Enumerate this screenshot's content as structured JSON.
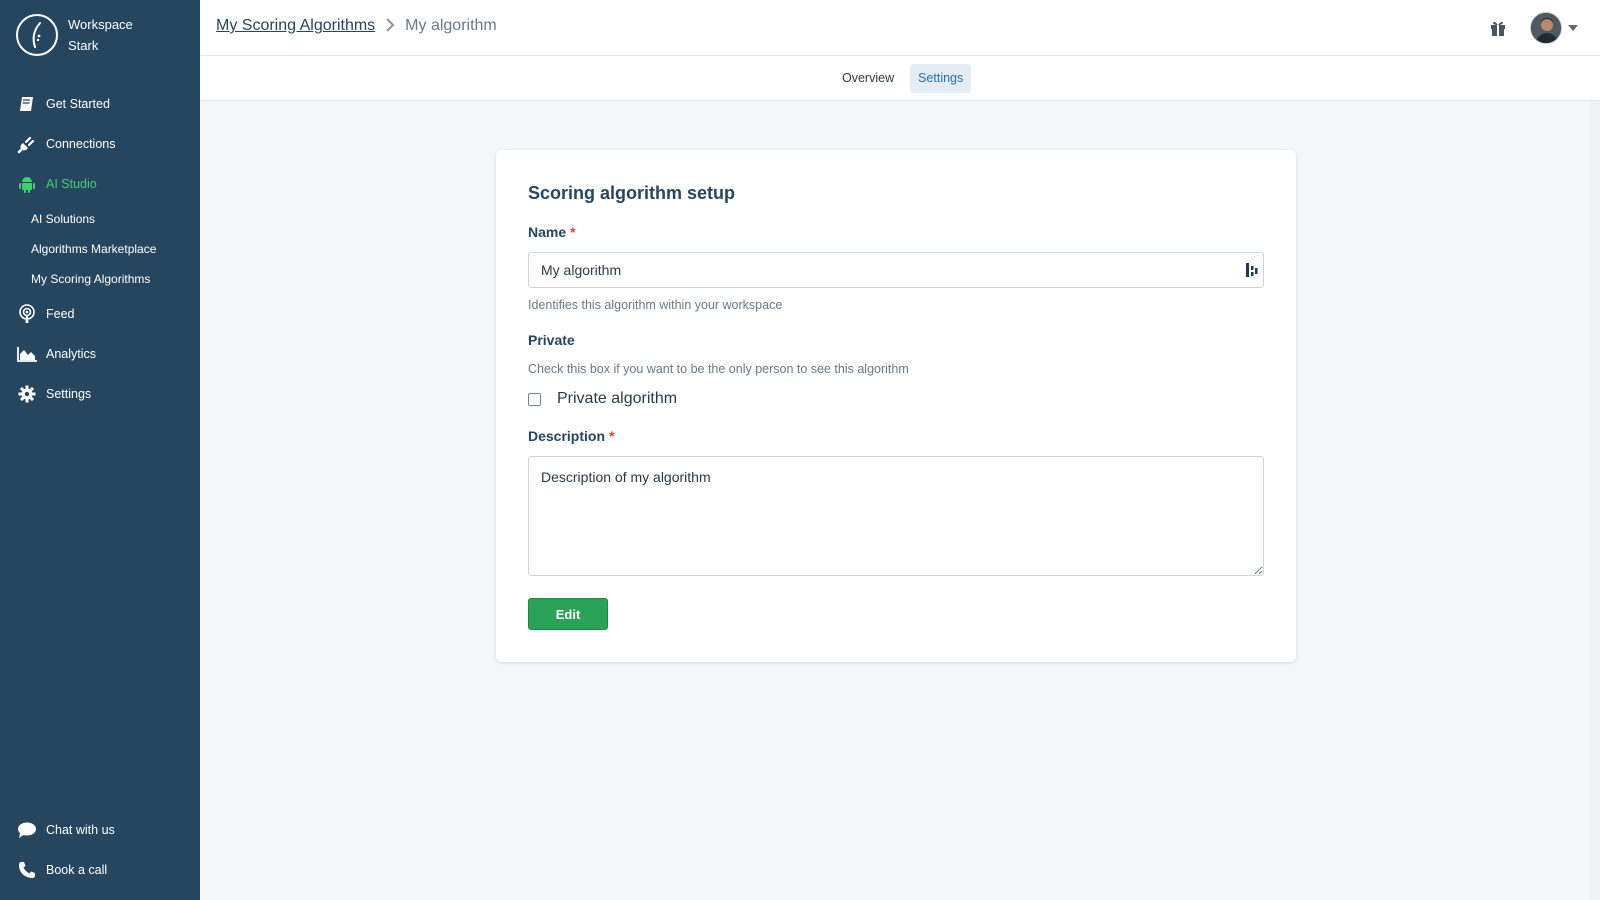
{
  "sidebar": {
    "brand": {
      "line1": "Workspace",
      "line2": "Stark"
    },
    "items": [
      {
        "label": "Get Started",
        "icon": "book-icon"
      },
      {
        "label": "Connections",
        "icon": "plug-icon"
      },
      {
        "label": "AI Studio",
        "icon": "android-icon",
        "active": true
      },
      {
        "label": "Feed",
        "icon": "podcast-icon"
      },
      {
        "label": "Analytics",
        "icon": "area-chart-icon"
      },
      {
        "label": "Settings",
        "icon": "gear-icon"
      }
    ],
    "sub_items": [
      {
        "label": "AI Solutions"
      },
      {
        "label": "Algorithms Marketplace"
      },
      {
        "label": "My Scoring Algorithms"
      }
    ],
    "bottom": [
      {
        "label": "Chat with us",
        "icon": "chat-icon"
      },
      {
        "label": "Book a call",
        "icon": "phone-icon"
      }
    ]
  },
  "header": {
    "breadcrumb_link": "My Scoring Algorithms",
    "breadcrumb_current": "My algorithm"
  },
  "tabs": [
    {
      "label": "Overview",
      "active": false
    },
    {
      "label": "Settings",
      "active": true
    }
  ],
  "form": {
    "title": "Scoring algorithm setup",
    "name_label": "Name",
    "required_mark": "*",
    "name_value": "My algorithm",
    "name_help": "Identifies this algorithm within your workspace",
    "private_label": "Private",
    "private_help": "Check this box if you want to be the only person to see this algorithm",
    "private_checkbox_label": "Private algorithm",
    "private_checked": false,
    "description_label": "Description",
    "description_value": "Description of my algorithm",
    "edit_button": "Edit"
  },
  "colors": {
    "sidebar_bg": "#26455f",
    "accent_green": "#3ecf6e",
    "button_green": "#2aa358",
    "required_red": "#e0462f"
  }
}
